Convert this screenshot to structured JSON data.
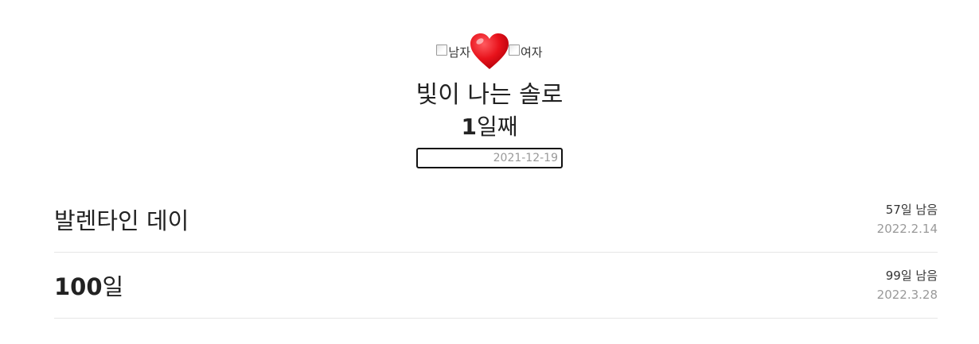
{
  "header": {
    "left_image_alt": "남자",
    "right_image_alt": "여자",
    "heart_icon": "heart-icon",
    "title": "빛이 나는 솔로",
    "day_number": "1",
    "day_suffix": "일째",
    "start_date": "2021-12-19"
  },
  "events": [
    {
      "title": "발렌타인 데이",
      "remaining": "57일 남음",
      "date": "2022.2.14"
    },
    {
      "title_number": "100",
      "title_suffix": "일",
      "remaining": "99일 남음",
      "date": "2022.3.28"
    }
  ],
  "colors": {
    "heart": "#e8121b",
    "text": "#222222",
    "muted": "#999999",
    "divider": "#e6e6e6"
  }
}
